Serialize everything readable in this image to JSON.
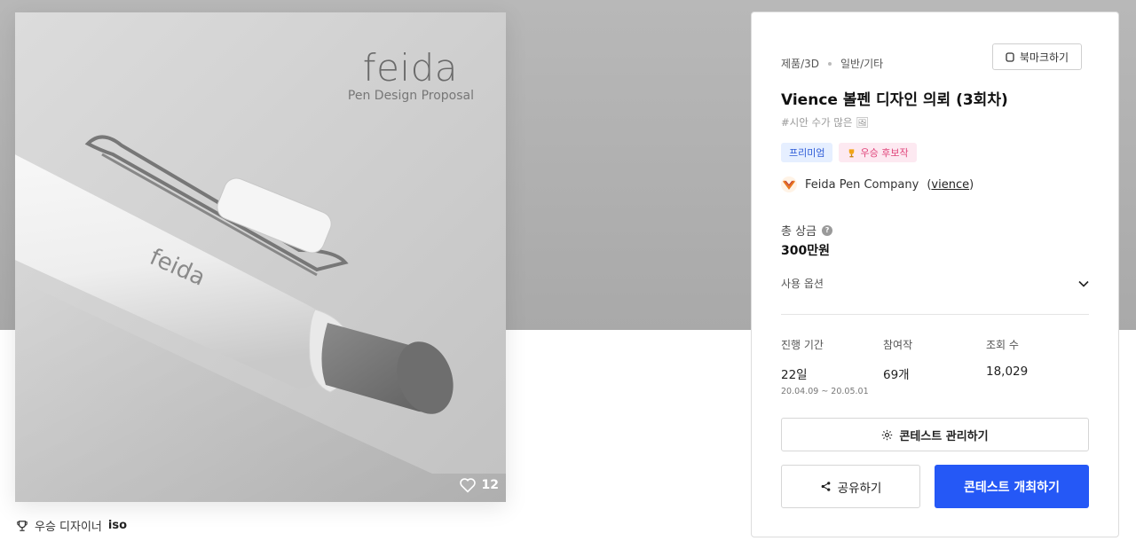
{
  "hero": {
    "brand_title": "feida",
    "brand_subtitle": "Pen Design Proposal",
    "pen_engraving": "feida",
    "like_count": "12"
  },
  "winner": {
    "label": "우승 디자이너",
    "name": "iso"
  },
  "contest": {
    "category": "제품/3D",
    "subcategory": "일반/기타",
    "bookmark_label": "북마크하기",
    "title": "Vience 볼펜 디자인 의뢰 (3회차)",
    "tag": "#시안 수가 많은 🖼",
    "badges": {
      "premium": "프리미엄",
      "award": "우승 후보작"
    },
    "company": {
      "name": "Feida Pen Company",
      "handle_open": "(",
      "handle": "vience",
      "handle_close": ")"
    },
    "prize": {
      "label": "총 상금",
      "value": "300만원"
    },
    "usage_label": "사용 옵션",
    "stats": {
      "duration": {
        "label": "진행 기간",
        "value": "22일",
        "range": "20.04.09 ~ 20.05.01"
      },
      "entries": {
        "label": "참여작",
        "value": "69개"
      },
      "views": {
        "label": "조회 수",
        "value": "18,029"
      }
    },
    "manage_label": "콘테스트 관리하기",
    "share_label": "공유하기",
    "host_label": "콘테스트 개최하기"
  },
  "colors": {
    "primary": "#2558f6",
    "premium_bg": "#e6efff",
    "premium_text": "#2d5bd7",
    "award_bg": "#fde9f1",
    "award_text": "#e0457b"
  },
  "icons": {
    "bookmark": "bookmark-icon",
    "help": "help-icon",
    "chevron": "chevron-down-icon",
    "gear": "gear-icon",
    "share": "share-icon",
    "heart": "heart-icon",
    "trophy": "trophy-icon"
  }
}
